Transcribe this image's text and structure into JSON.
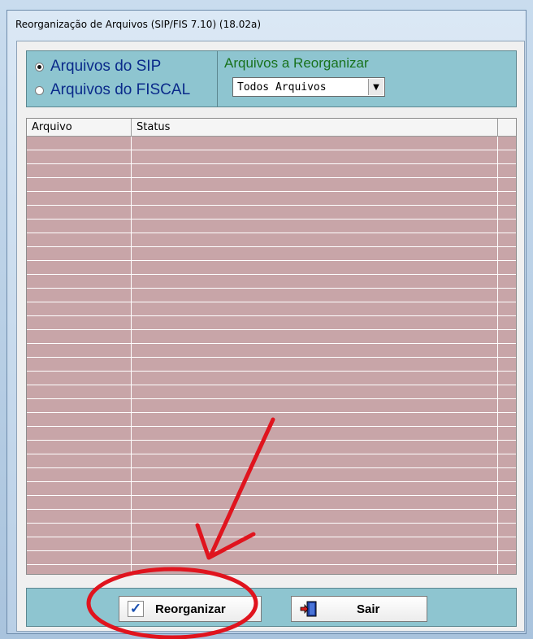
{
  "window": {
    "title": "Reorganização de Arquivos (SIP/FIS 7.10) (18.02a)"
  },
  "source_group": {
    "options": [
      {
        "label": "Arquivos do SIP",
        "checked": true
      },
      {
        "label": "Arquivos do FISCAL",
        "checked": false
      }
    ]
  },
  "files_to_reorganize": {
    "label": "Arquivos a Reorganizar",
    "selected": "Todos Arquivos"
  },
  "grid": {
    "columns": [
      "Arquivo",
      "Status"
    ],
    "rows": []
  },
  "buttons": {
    "reorganize": "Reorganizar",
    "exit": "Sair"
  },
  "colors": {
    "panel": "#8ec5d0",
    "grid_rows": "#c8a5a8",
    "annotation": "#e0141e",
    "label_green": "#18721d",
    "radio_text": "#0a2a8a"
  }
}
